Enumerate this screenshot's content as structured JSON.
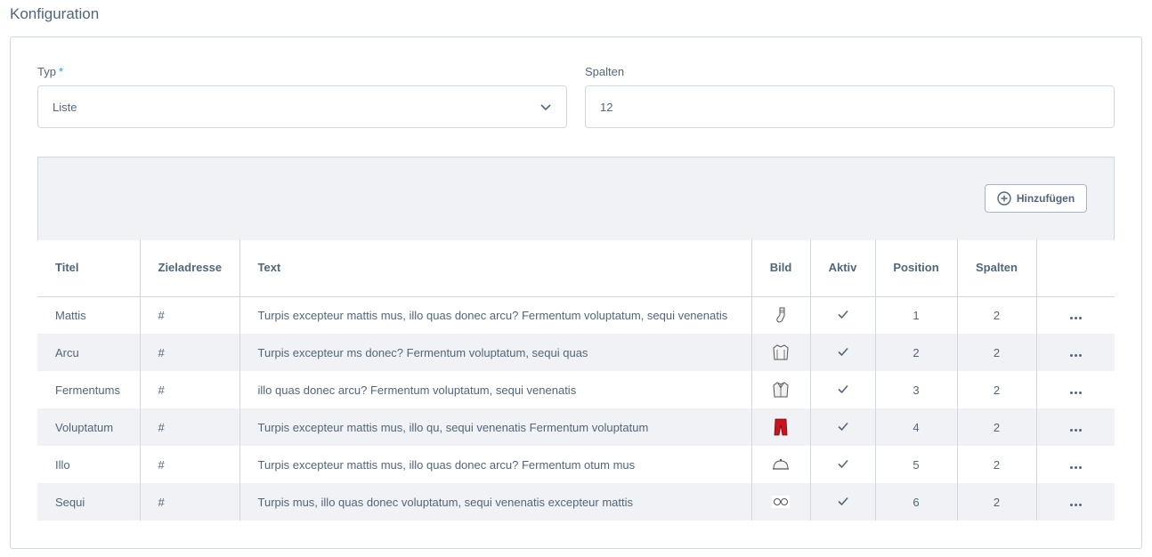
{
  "page": {
    "title": "Konfiguration"
  },
  "form": {
    "typ_label": "Typ",
    "required_marker": "*",
    "typ_value": "Liste",
    "spalten_label": "Spalten",
    "spalten_value": "12"
  },
  "toolbar": {
    "add_label": "Hinzufügen"
  },
  "table": {
    "headers": [
      "Titel",
      "Zieladresse",
      "Text",
      "Bild",
      "Aktiv",
      "Position",
      "Spalten"
    ],
    "rows": [
      {
        "titel": "Mattis",
        "ziel": "#",
        "text": "Turpis excepteur mattis mus, illo quas donec arcu? Fermentum voluptatum, sequi venenatis",
        "bild": "sock-icon",
        "aktiv": true,
        "position": "1",
        "spalten": "2"
      },
      {
        "titel": "Arcu",
        "ziel": "#",
        "text": "Turpis excepteur ms donec? Fermentum voluptatum, sequi quas",
        "bild": "shirt-icon",
        "aktiv": true,
        "position": "2",
        "spalten": "2"
      },
      {
        "titel": "Fermentums",
        "ziel": "#",
        "text": "illo quas donec arcu? Fermentum voluptatum, sequi venenatis",
        "bild": "jacket-icon",
        "aktiv": true,
        "position": "3",
        "spalten": "2"
      },
      {
        "titel": "Voluptatum",
        "ziel": "#",
        "text": "Turpis excepteur mattis mus, illo qu, sequi venenatis Fermentum voluptatum",
        "bild": "trousers-icon",
        "aktiv": true,
        "position": "4",
        "spalten": "2"
      },
      {
        "titel": "Illo",
        "ziel": "#",
        "text": "Turpis excepteur mattis mus, illo quas donec arcu? Fermentum otum mus",
        "bild": "cap-icon",
        "aktiv": true,
        "position": "5",
        "spalten": "2"
      },
      {
        "titel": "Sequi",
        "ziel": "#",
        "text": "Turpis mus, illo quas donec voluptatum, sequi venenatis excepteur mattis",
        "bild": "glasses-icon",
        "aktiv": true,
        "position": "6",
        "spalten": "2"
      }
    ]
  },
  "colors": {
    "text": "#52667a",
    "border": "#d1d9e0",
    "stripe": "#f0f2f5",
    "accent": "#189eff",
    "trousers": "#c8141e"
  }
}
